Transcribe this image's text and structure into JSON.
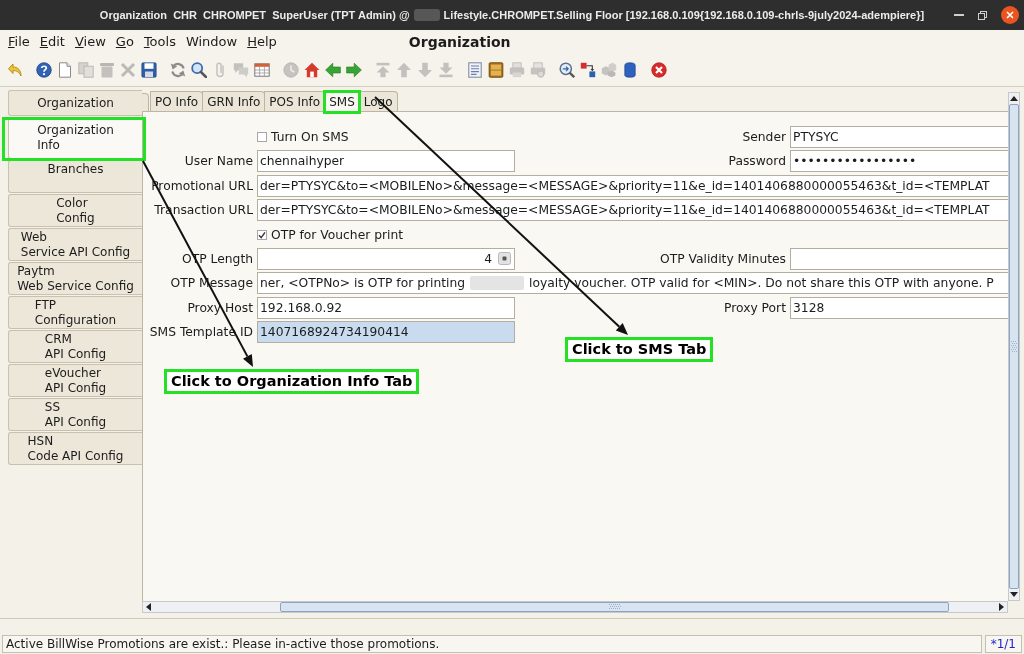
{
  "window": {
    "title_parts": [
      "Organization  CHR  CHROMPET  SuperUser (TPT Admin) @",
      "Lifestyle.CHROMPET.Selling Floor [192.168.0.109{192.168.0.109-chrls-9july2024-adempiere}]"
    ]
  },
  "menu": [
    {
      "label": "File",
      "mnemonic": true
    },
    {
      "label": "Edit",
      "mnemonic": true
    },
    {
      "label": "View",
      "mnemonic": true
    },
    {
      "label": "Go",
      "mnemonic": true
    },
    {
      "label": "Tools",
      "mnemonic": true
    },
    {
      "label": "Window",
      "mnemonic": false
    },
    {
      "label": "Help",
      "mnemonic": true
    }
  ],
  "window_heading": "Organization",
  "toolbar": [
    [
      {
        "kind": "undo",
        "disabled": false
      }
    ],
    [
      {
        "kind": "help",
        "disabled": false
      },
      {
        "kind": "new",
        "disabled": false
      },
      {
        "kind": "copy",
        "disabled": true
      },
      {
        "kind": "delete",
        "disabled": true
      },
      {
        "kind": "remove",
        "disabled": true
      },
      {
        "kind": "save",
        "disabled": false
      }
    ],
    [
      {
        "kind": "refresh",
        "disabled": false
      },
      {
        "kind": "find",
        "disabled": false
      },
      {
        "kind": "attach",
        "disabled": true
      },
      {
        "kind": "chat",
        "disabled": true
      },
      {
        "kind": "grid",
        "disabled": false
      }
    ],
    [
      {
        "kind": "history",
        "disabled": true
      },
      {
        "kind": "home",
        "disabled": false
      },
      {
        "kind": "back",
        "disabled": false
      },
      {
        "kind": "forward",
        "disabled": false
      }
    ],
    [
      {
        "kind": "first",
        "disabled": true
      },
      {
        "kind": "previous",
        "disabled": true
      },
      {
        "kind": "next",
        "disabled": true
      },
      {
        "kind": "last",
        "disabled": true
      }
    ],
    [
      {
        "kind": "report",
        "disabled": false
      },
      {
        "kind": "archive",
        "disabled": false
      },
      {
        "kind": "print",
        "disabled": true
      },
      {
        "kind": "preview",
        "disabled": true
      }
    ],
    [
      {
        "kind": "zoom",
        "disabled": false
      },
      {
        "kind": "request",
        "disabled": false
      },
      {
        "kind": "info",
        "disabled": true
      },
      {
        "kind": "workflow",
        "disabled": false
      }
    ],
    [
      {
        "kind": "close",
        "disabled": false
      }
    ]
  ],
  "sidebar_tabs": [
    {
      "label": "Organization",
      "selected": false,
      "highlighted": false
    },
    {
      "label": "Organization\nInfo",
      "selected": true,
      "highlighted": true
    },
    {
      "label": "Branches",
      "selected": false,
      "highlighted": false
    },
    {
      "label": "Color\nConfig",
      "selected": false,
      "highlighted": false
    },
    {
      "label": "Web\nService API Config",
      "selected": false,
      "highlighted": false
    },
    {
      "label": "Paytm\nWeb Service Config",
      "selected": false,
      "highlighted": false
    },
    {
      "label": "FTP\nConfiguration",
      "selected": false,
      "highlighted": false
    },
    {
      "label": "CRM\nAPI Config",
      "selected": false,
      "highlighted": false
    },
    {
      "label": "eVoucher\nAPI Config",
      "selected": false,
      "highlighted": false
    },
    {
      "label": "SS\nAPI Config",
      "selected": false,
      "highlighted": false
    },
    {
      "label": "HSN\nCode API Config",
      "selected": false,
      "highlighted": false
    }
  ],
  "tabs": [
    {
      "label": "PO Info",
      "selected": false,
      "highlighted": false
    },
    {
      "label": "GRN Info",
      "selected": false,
      "highlighted": false
    },
    {
      "label": "POS Info",
      "selected": false,
      "highlighted": false
    },
    {
      "label": "SMS",
      "selected": true,
      "highlighted": true
    },
    {
      "label": "Logo",
      "selected": false,
      "highlighted": false
    }
  ],
  "form": {
    "rows": [
      {
        "items": [
          {
            "kind": "checkbox",
            "label": "Turn On SMS",
            "checked": false
          },
          {
            "kind": "text",
            "label": "Sender",
            "value": "PTYSYC",
            "focused": false
          }
        ]
      },
      {
        "items": [
          {
            "kind": "text",
            "label": "User Name",
            "value": "chennaihyper",
            "focused": false
          },
          {
            "kind": "password",
            "label": "Password",
            "value": "•••••••••••••••••",
            "focused": false
          }
        ]
      },
      {
        "items": [
          {
            "kind": "wide",
            "label": "Promotional URL",
            "value": "der=PTYSYC&to=<MOBILENo>&message=<MESSAGE>&priority=11&e_id=1401406880000055463&t_id=<TEMPLAT",
            "focused": false
          }
        ]
      },
      {
        "items": [
          {
            "kind": "wide",
            "label": "Transaction URL",
            "value": "der=PTYSYC&to=<MOBILENo>&message=<MESSAGE>&priority=11&e_id=1401406880000055463&t_id=<TEMPLAT",
            "focused": false
          }
        ]
      },
      {
        "items": [
          {
            "kind": "checkbox",
            "label": "OTP for Voucher print",
            "checked": true
          }
        ]
      },
      {
        "items": [
          {
            "kind": "number",
            "label": "OTP Length",
            "value": "4",
            "focused": false
          },
          {
            "kind": "text",
            "label": "OTP Validity Minutes",
            "focused": false
          }
        ]
      },
      {
        "items": [
          {
            "kind": "redacted",
            "label": "OTP Message",
            "value_parts": [
              "ner, <OTPNo> is OTP for printing",
              "loyalty voucher. OTP valid for <MIN>. Do not share this OTP with anyone. P"
            ],
            "focused": false
          }
        ]
      },
      {
        "items": [
          {
            "kind": "text",
            "label": "Proxy Host",
            "value": "192.168.0.92",
            "focused": false
          },
          {
            "kind": "text",
            "label": "Proxy Port",
            "value": "3128",
            "focused": false
          }
        ]
      },
      {
        "items": [
          {
            "kind": "text",
            "label": "SMS Template ID",
            "value": "1407168924734190414",
            "focused": true
          }
        ]
      }
    ]
  },
  "callouts": [
    {
      "text": "Click to Organization Info Tab"
    },
    {
      "text": "Click to SMS Tab"
    }
  ],
  "status_bar": {
    "message": "Active BillWise Promotions are exist.: Please in-active those promotions.",
    "record_count": "*1/1"
  }
}
